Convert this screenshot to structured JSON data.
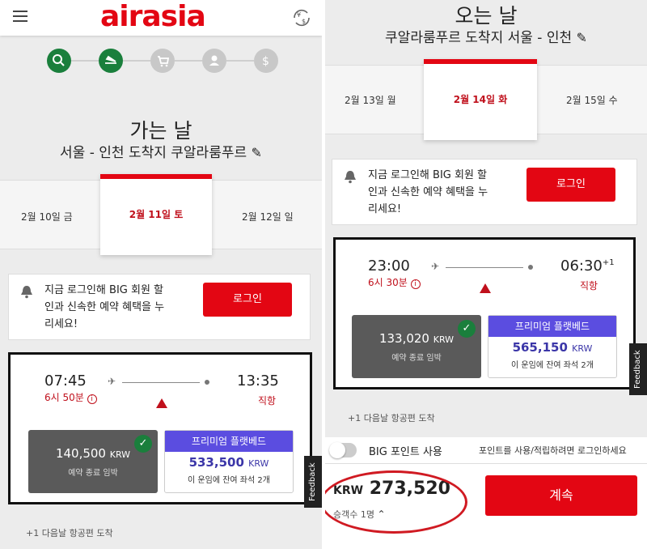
{
  "left": {
    "logo": "airasia",
    "currency_icon": "¥$",
    "steps": [
      {
        "icon": "search-icon",
        "glyph": "⌕"
      },
      {
        "icon": "plane-icon",
        "glyph": "✈"
      },
      {
        "icon": "cart-icon",
        "glyph": "🛒"
      },
      {
        "icon": "person-icon",
        "glyph": "●"
      },
      {
        "icon": "dollar-icon",
        "glyph": "$"
      }
    ],
    "title": "가는 날",
    "route": "서울 - 인천 도착지 쿠알라룸푸르",
    "dates": {
      "prev": "2월 10일 금",
      "selected": "2월 11일 토",
      "next": "2월 12일 일"
    },
    "login_message": [
      "지금 로그인해 BIG 회원 할",
      "인과 신속한 예약 혜택을 누",
      "리세요!"
    ],
    "login_button": "로그인",
    "flight": {
      "depart": "07:45",
      "arrive": "13:35",
      "duration": "6시 50분",
      "type": "직항",
      "fare_value": "140,500",
      "fare_currency": "KRW",
      "fare_note": "예약 종료 임박",
      "premium_header": "프리미엄 플랫베드",
      "premium_value": "533,500",
      "premium_currency": "KRW",
      "premium_note": "이 운임에 잔여 좌석 2개"
    },
    "feedback": "Feedback",
    "next_day_note": "+1 다음날 항공편 도착"
  },
  "right": {
    "title": "오는 날",
    "route": "쿠알라룸푸르 도착지 서울 - 인천",
    "dates": {
      "prev": "2월 13일 월",
      "selected": "2월 14일 화",
      "next": "2월 15일 수"
    },
    "login_message": [
      "지금 로그인해 BIG 회원 할",
      "인과 신속한 예약 혜택을 누",
      "리세요!"
    ],
    "login_button": "로그인",
    "flight": {
      "depart": "23:00",
      "arrive": "06:30",
      "arrive_sup": "+1",
      "duration": "6시 30분",
      "type": "직항",
      "fare_value": "133,020",
      "fare_currency": "KRW",
      "fare_note": "예약 종료 임박",
      "premium_header": "프리미엄 플랫베드",
      "premium_value": "565,150",
      "premium_currency": "KRW",
      "premium_note": "이 운임에 잔여 좌석 2개"
    },
    "feedback": "Feedback",
    "next_day_note": "+1 다음날 항공편 도착",
    "points_label": "BIG 포인트 사용",
    "points_note": "포인트를 사용/적립하려면 로그인하세요",
    "total_currency": "KRW",
    "total_value": "273,520",
    "passengers": "승객수 1명",
    "continue_button": "계속"
  },
  "colors": {
    "brand_red": "#e30613",
    "green": "#1a7f3c",
    "premium_purple": "#5b4de0"
  }
}
